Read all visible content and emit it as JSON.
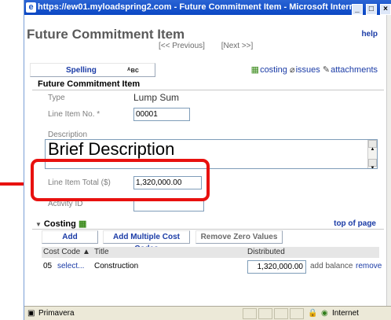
{
  "window": {
    "title": "https://ew01.myloadspring2.com - Future Commitment Item - Microsoft Internet Explorer provided ...",
    "controls": [
      "_",
      "□",
      "×"
    ]
  },
  "page": {
    "title": "Future Commitment Item",
    "help": "help",
    "prev": "[<< Previous]",
    "next": "[Next >>]"
  },
  "toolbar": {
    "spelling": "Spelling",
    "spelling_icon": "ᴬʙᴄ",
    "costing": "costing",
    "issues": "issues",
    "attachments": "attachments"
  },
  "form": {
    "section_title": "Future Commitment Item",
    "type_label": "Type",
    "type_value": "Lump Sum",
    "line_no_label": "Line Item No. *",
    "line_no_value": "00001",
    "desc_label": "Description",
    "desc_value": "Brief Description",
    "total_label": "Line Item Total ($)",
    "total_value": "1,320,000.00",
    "activity_label": "Activity ID",
    "activity_value": ""
  },
  "costing": {
    "title": "Costing",
    "top_of_page": "top of page",
    "buttons": {
      "add": "Add",
      "add_multiple": "Add Multiple Cost Codes",
      "remove_zero": "Remove Zero Values"
    },
    "columns": {
      "cost_code": "Cost Code ▲",
      "title": "Title",
      "distributed": "Distributed"
    },
    "rows": [
      {
        "code": "05",
        "select": "select...",
        "title": "Construction",
        "distributed": "1,320,000.00",
        "add_balance": "add balance",
        "remove": "remove"
      }
    ]
  },
  "status": {
    "left": "Primavera",
    "zone": "Internet"
  },
  "colors": {
    "title_bar": "#0b47c4",
    "link": "#1a3ba6",
    "highlight": "#e8110f"
  }
}
